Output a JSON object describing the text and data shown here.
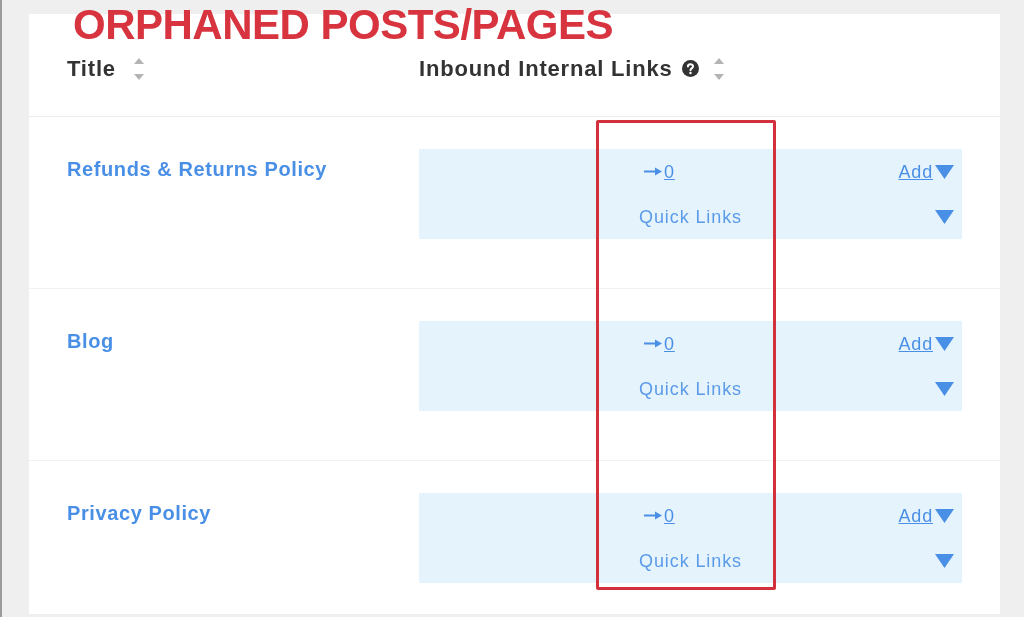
{
  "heading": "ORPHANED POSTS/PAGES",
  "table": {
    "columns": [
      {
        "label": "Title",
        "sortable": true,
        "help": false
      },
      {
        "label": "Inbound Internal Links",
        "sortable": true,
        "help": true
      }
    ],
    "rows": [
      {
        "title": "Refunds & Returns Policy",
        "inbound_count": "0",
        "add_label": "Add",
        "quick_links_label": "Quick Links"
      },
      {
        "title": "Blog",
        "inbound_count": "0",
        "add_label": "Add",
        "quick_links_label": "Quick Links"
      },
      {
        "title": "Privacy Policy",
        "inbound_count": "0",
        "add_label": "Add",
        "quick_links_label": "Quick Links"
      }
    ]
  }
}
